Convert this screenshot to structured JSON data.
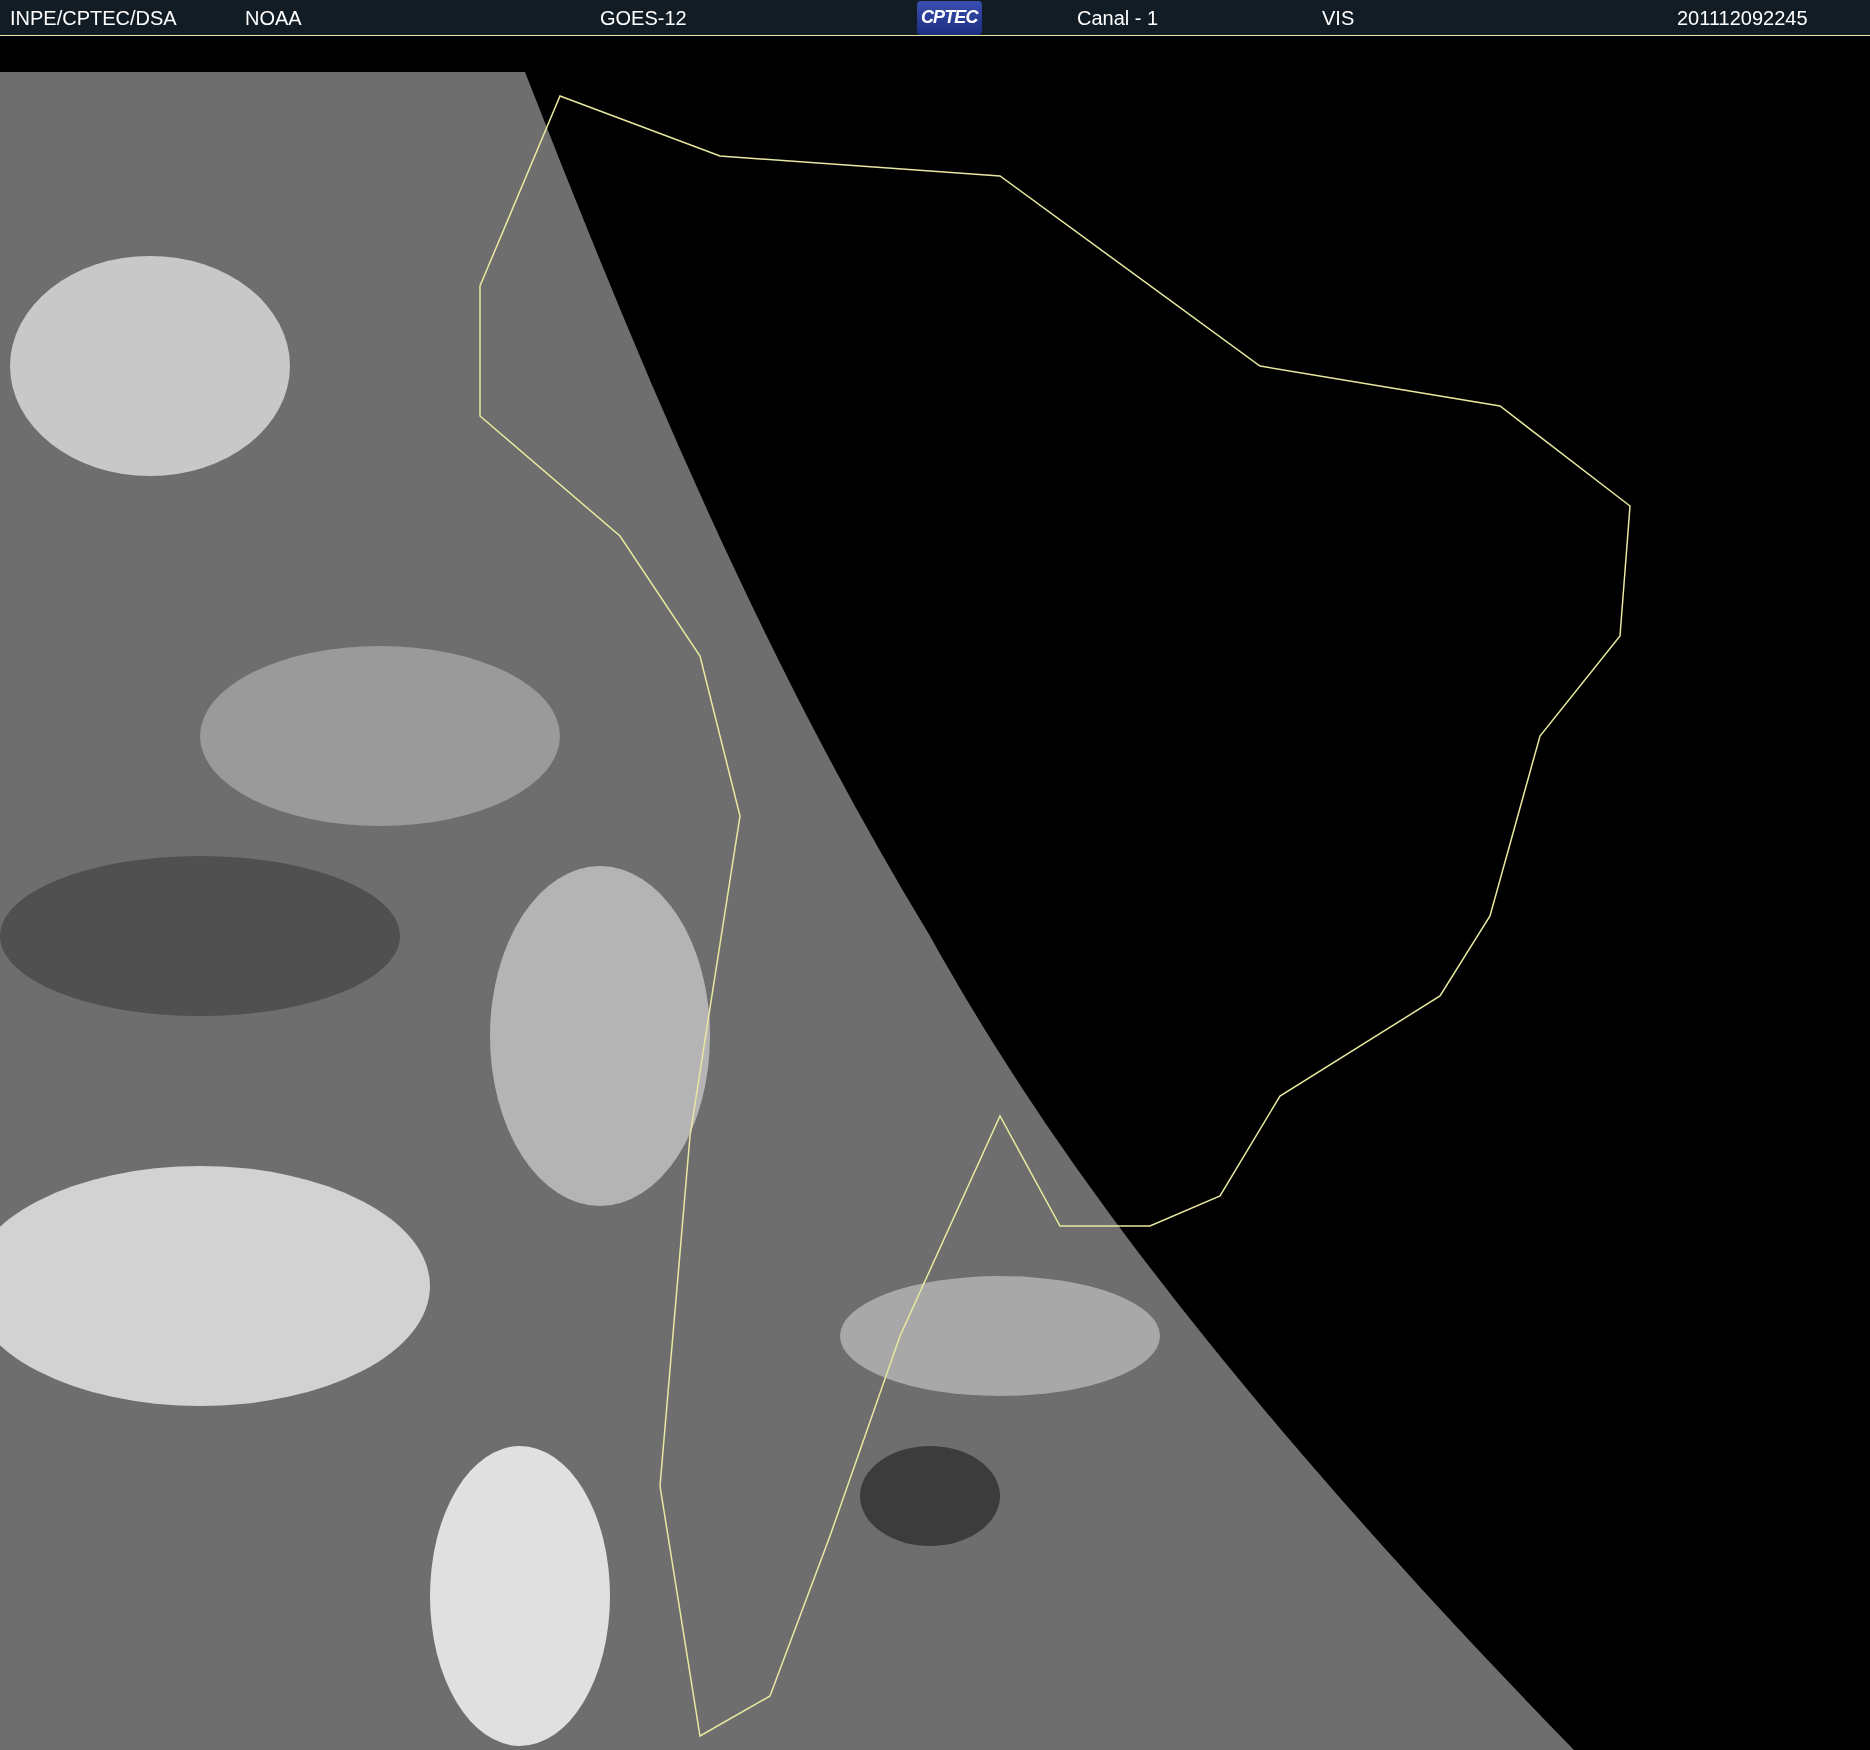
{
  "header": {
    "items": [
      {
        "kind": "text",
        "label": "INPE/CPTEC/DSA"
      },
      {
        "kind": "text",
        "label": "NOAA"
      },
      {
        "kind": "text",
        "label": "GOES-12"
      },
      {
        "kind": "logo",
        "label": "CPTEC"
      },
      {
        "kind": "text",
        "label": "Canal - 1"
      },
      {
        "kind": "text",
        "label": "VIS"
      },
      {
        "kind": "text",
        "label": "201112092245"
      }
    ]
  }
}
